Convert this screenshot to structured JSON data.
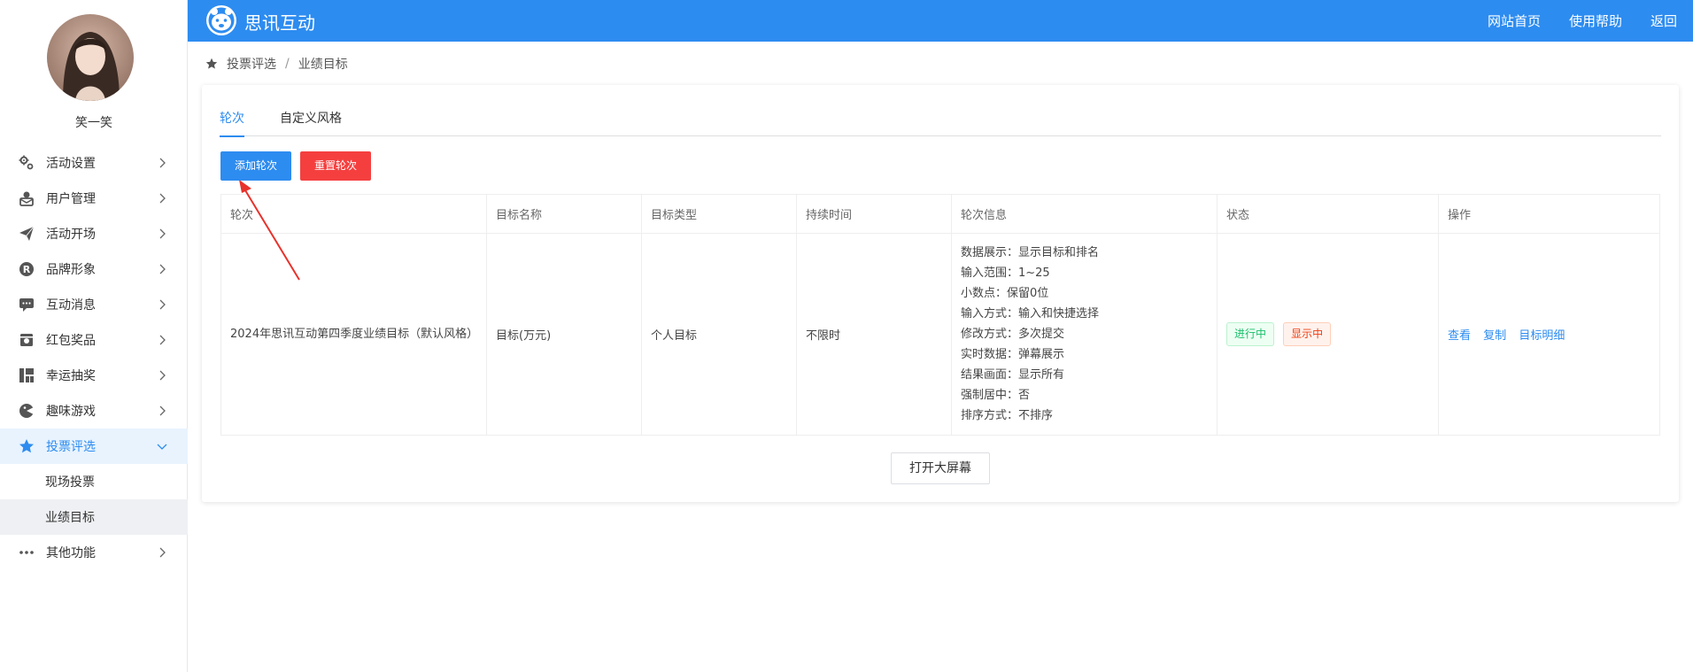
{
  "app": {
    "title": "思讯互动"
  },
  "user": {
    "name": "笑一笑"
  },
  "top_nav": [
    {
      "label": "网站首页"
    },
    {
      "label": "使用帮助"
    },
    {
      "label": "返回"
    }
  ],
  "sidebar": {
    "items": [
      {
        "label": "活动设置",
        "icon": "gears-icon"
      },
      {
        "label": "用户管理",
        "icon": "user-icon"
      },
      {
        "label": "活动开场",
        "icon": "paper-plane-icon"
      },
      {
        "label": "品牌形象",
        "icon": "registered-icon"
      },
      {
        "label": "互动消息",
        "icon": "message-icon"
      },
      {
        "label": "红包奖品",
        "icon": "gift-icon"
      },
      {
        "label": "幸运抽奖",
        "icon": "lottery-icon"
      },
      {
        "label": "趣味游戏",
        "icon": "game-icon"
      },
      {
        "label": "投票评选",
        "icon": "star-icon",
        "active": true
      },
      {
        "label": "其他功能",
        "icon": "more-icon"
      }
    ],
    "sub_items": [
      {
        "label": "现场投票"
      },
      {
        "label": "业绩目标",
        "selected": true
      }
    ]
  },
  "breadcrumb": {
    "parent": "投票评选",
    "separator": "/",
    "current": "业绩目标"
  },
  "tabs": [
    {
      "label": "轮次",
      "active": true
    },
    {
      "label": "自定义风格"
    }
  ],
  "actions": {
    "add_round": "添加轮次",
    "reset_round": "重置轮次"
  },
  "table": {
    "headers": [
      "轮次",
      "目标名称",
      "目标类型",
      "持续时间",
      "轮次信息",
      "状态",
      "操作"
    ],
    "rows": [
      {
        "round": "2024年思讯互动第四季度业绩目标（默认风格）",
        "target_name": "目标(万元)",
        "target_type": "个人目标",
        "duration": "不限时",
        "info": [
          "数据展示：显示目标和排名",
          "输入范围：1~25",
          "小数点：保留0位",
          "输入方式：输入和快捷选择",
          "修改方式：多次提交",
          "实时数据：弹幕展示",
          "结果画面：显示所有",
          "强制居中：否",
          "排序方式：不排序"
        ],
        "status": [
          "进行中",
          "显示中"
        ],
        "ops": [
          "查看",
          "复制",
          "目标明细"
        ]
      }
    ]
  },
  "open_screen": "打开大屏幕",
  "colors": {
    "primary": "#2d8cf0",
    "danger": "#f53f3f",
    "annotation": "#e8322c"
  }
}
